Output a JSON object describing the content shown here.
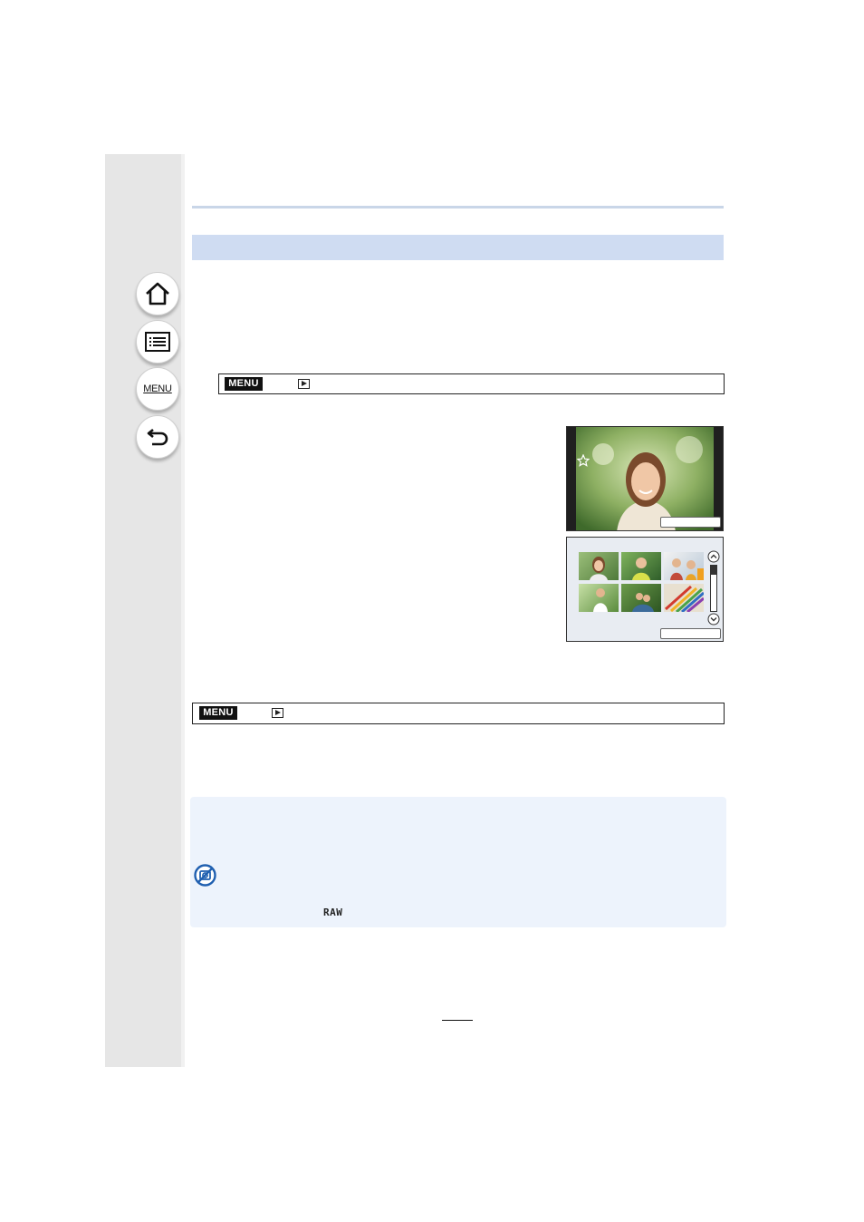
{
  "sidebar": {
    "buttons": [
      {
        "name": "home",
        "icon": "home-icon"
      },
      {
        "name": "contents",
        "icon": "list-icon"
      },
      {
        "name": "menu",
        "icon": "menu-icon",
        "label": "MENU"
      },
      {
        "name": "back",
        "icon": "back-arrow-icon"
      }
    ]
  },
  "menu_paths": [
    {
      "badge": "MENU",
      "icon": "playback-icon"
    },
    {
      "badge": "MENU",
      "icon": "playback-icon"
    }
  ],
  "notes": {
    "icon": "not-available-icon",
    "raw_label": "RAW"
  },
  "colors": {
    "sidebar": "#e6e6e6",
    "section_bar": "#cfdcf2",
    "note_panel": "#edf3fc",
    "no_icon": "#1f5fb0"
  }
}
